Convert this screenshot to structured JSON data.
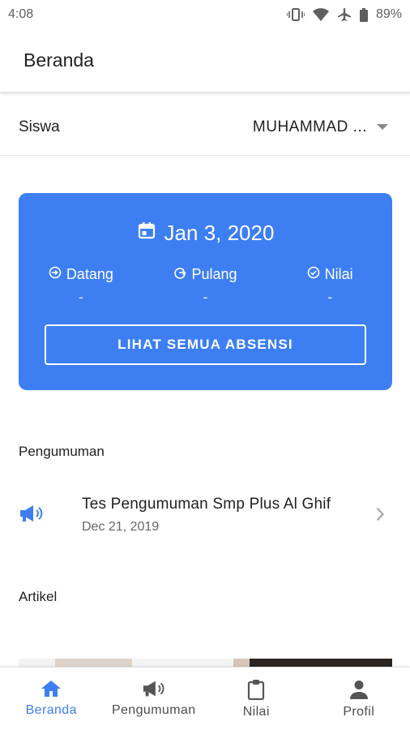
{
  "status_bar": {
    "time": "4:08",
    "battery": "89%"
  },
  "app_bar": {
    "title": "Beranda"
  },
  "student": {
    "label": "Siswa",
    "selected": "MUHAMMAD ..."
  },
  "attendance_card": {
    "date": "Jan 3, 2020",
    "stats": [
      {
        "label": "Datang",
        "value": "-"
      },
      {
        "label": "Pulang",
        "value": "-"
      },
      {
        "label": "Nilai",
        "value": "-"
      }
    ],
    "button_label": "LIHAT SEMUA ABSENSI"
  },
  "announcements": {
    "section_title": "Pengumuman",
    "items": [
      {
        "title": "Tes Pengumuman Smp Plus Al Ghif",
        "date": "Dec 21, 2019"
      }
    ]
  },
  "articles": {
    "section_title": "Artikel"
  },
  "bottom_nav": {
    "items": [
      {
        "label": "Beranda",
        "icon": "home-icon",
        "active": true
      },
      {
        "label": "Pengumuman",
        "icon": "megaphone-icon",
        "active": false
      },
      {
        "label": "Nilai",
        "icon": "clipboard-icon",
        "active": false
      },
      {
        "label": "Profil",
        "icon": "person-icon",
        "active": false
      }
    ]
  },
  "colors": {
    "accent": "#3d7ff3",
    "text": "#212121",
    "muted": "#666666"
  }
}
